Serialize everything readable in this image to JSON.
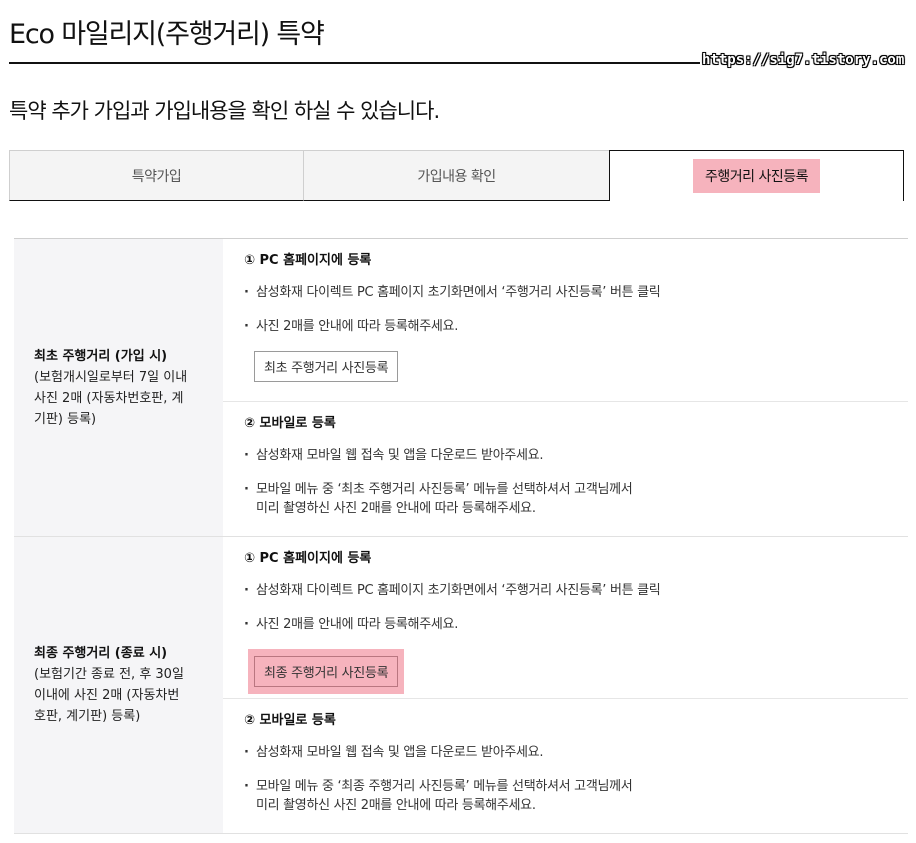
{
  "page": {
    "title": "Eco 마일리지(주행거리) 특약",
    "watermark": "https://sig7.tistory.com",
    "subtitle": "특약 추가 가입과 가입내용을 확인 하실 수 있습니다."
  },
  "tabs": [
    {
      "label": "특약가입",
      "active": false
    },
    {
      "label": "가입내용 확인",
      "active": false
    },
    {
      "label": "주행거리 사진등록",
      "active": true
    }
  ],
  "colors": {
    "highlight": "#f6b3bd",
    "head_bg": "#f5f5f7"
  },
  "sections": [
    {
      "title": "최초 주행거리 (가입 시)",
      "desc_lines": [
        "(보험개시일로부터 7일 이내",
        "사진 2매 (자동차번호판, 계",
        "기판) 등록)"
      ],
      "pc": {
        "title": "① PC 홈페이지에 등록",
        "bullets": [
          "삼성화재 다이렉트 PC 홈페이지 초기화면에서 ‘주행거리 사진등록’ 버튼 클릭",
          "사진 2매를 안내에 따라 등록해주세요."
        ],
        "button": "최초 주행거리 사진등록"
      },
      "mobile": {
        "title": "② 모바일로 등록",
        "bullet1": "삼성화재 모바일 웹 접속 및 앱을 다운로드 받아주세요.",
        "bullet2_line1": "모바일 메뉴 중 ‘최초 주행거리 사진등록’ 메뉴를 선택하셔서 고객님께서",
        "bullet2_line2": "미리 촬영하신 사진 2매를 안내에 따라 등록해주세요."
      }
    },
    {
      "title": "최종 주행거리 (종료 시)",
      "desc_lines": [
        "(보험기간 종료 전, 후 30일",
        "이내에 사진 2매 (자동차번",
        "호판, 계기판) 등록)"
      ],
      "pc": {
        "title": "① PC 홈페이지에 등록",
        "bullets": [
          "삼성화재 다이렉트 PC 홈페이지 초기화면에서 ‘주행거리 사진등록’ 버튼 클릭",
          "사진 2매를 안내에 따라 등록해주세요."
        ],
        "button": "최종 주행거리 사진등록"
      },
      "mobile": {
        "title": "② 모바일로 등록",
        "bullet1": "삼성화재 모바일 웹 접속 및 앱을 다운로드 받아주세요.",
        "bullet2_line1": "모바일 메뉴 중 ‘최종 주행거리 사진등록’ 메뉴를 선택하셔서 고객님께서",
        "bullet2_line2": "미리 촬영하신 사진 2매를 안내에 따라 등록해주세요."
      }
    }
  ]
}
